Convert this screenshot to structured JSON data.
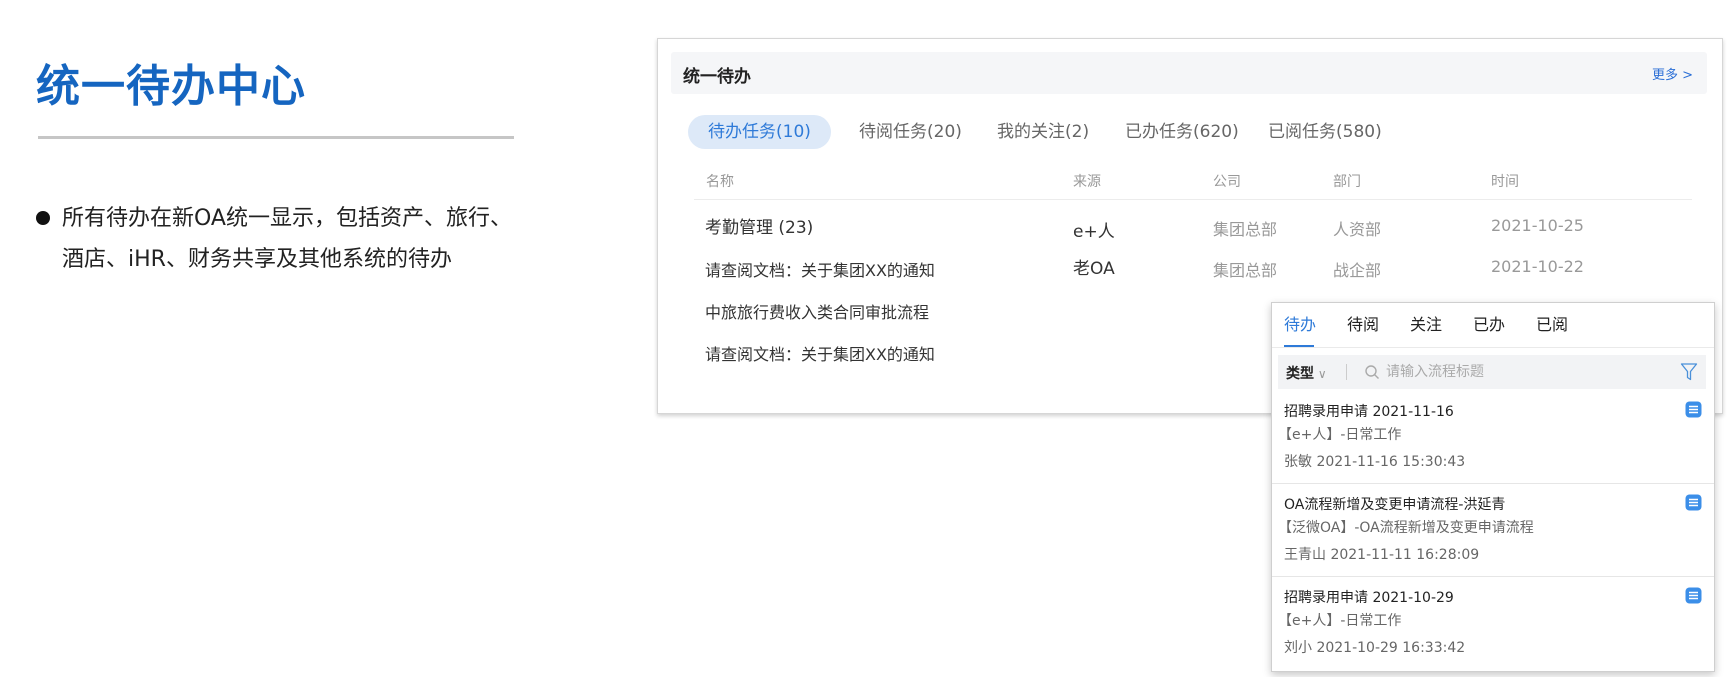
{
  "slide": {
    "title": "统一待办中心",
    "bullet": "所有待办在新OA统一显示，包括资产、旅行、酒店、iHR、财务共享及其他系统的待办"
  },
  "panel": {
    "title": "统一待办",
    "more": "更多 >",
    "tabs": [
      {
        "label": "待办任务(10)",
        "active": true
      },
      {
        "label": "待阅任务(20)",
        "active": false
      },
      {
        "label": "我的关注(2)",
        "active": false
      },
      {
        "label": "已办任务(620)",
        "active": false
      },
      {
        "label": "已阅任务(580)",
        "active": false
      }
    ],
    "columns": [
      "名称",
      "来源",
      "公司",
      "部门",
      "时间"
    ],
    "rows": [
      {
        "name": "考勤管理 (23)",
        "source": "e+人",
        "company": "集团总部",
        "dept": "人资部",
        "time": "2021-10-25"
      },
      {
        "name": "请查阅文档：关于集团XX的通知",
        "source": "老OA",
        "company": "集团总部",
        "dept": "战企部",
        "time": "2021-10-22"
      },
      {
        "name": "中旅旅行费收入类合同审批流程",
        "source": "",
        "company": "",
        "dept": "",
        "time": ""
      },
      {
        "name": "请查阅文档：关于集团XX的通知",
        "source": "",
        "company": "",
        "dept": "",
        "time": ""
      }
    ]
  },
  "popup": {
    "tabs": [
      {
        "label": "待办",
        "active": true
      },
      {
        "label": "待阅",
        "active": false
      },
      {
        "label": "关注",
        "active": false
      },
      {
        "label": "已办",
        "active": false
      },
      {
        "label": "已阅",
        "active": false
      }
    ],
    "type_label": "类型",
    "search_placeholder": "请输入流程标题",
    "items": [
      {
        "title": "招聘录用申请 2021-11-16",
        "sub": "【e+人】-日常工作",
        "meta": "张敏 2021-11-16 15:30:43"
      },
      {
        "title": "OA流程新增及变更申请流程-洪延青",
        "sub": "【泛微OA】-OA流程新增及变更申请流程",
        "meta": "王青山 2021-11-11 16:28:09"
      },
      {
        "title": "招聘录用申请 2021-10-29",
        "sub": "【e+人】-日常工作",
        "meta": "刘小 2021-10-29 16:33:42"
      }
    ]
  },
  "colors": {
    "accent": "#2e7ad8",
    "title_blue": "#1565c0",
    "tab_active_bg": "#dde9f8"
  }
}
